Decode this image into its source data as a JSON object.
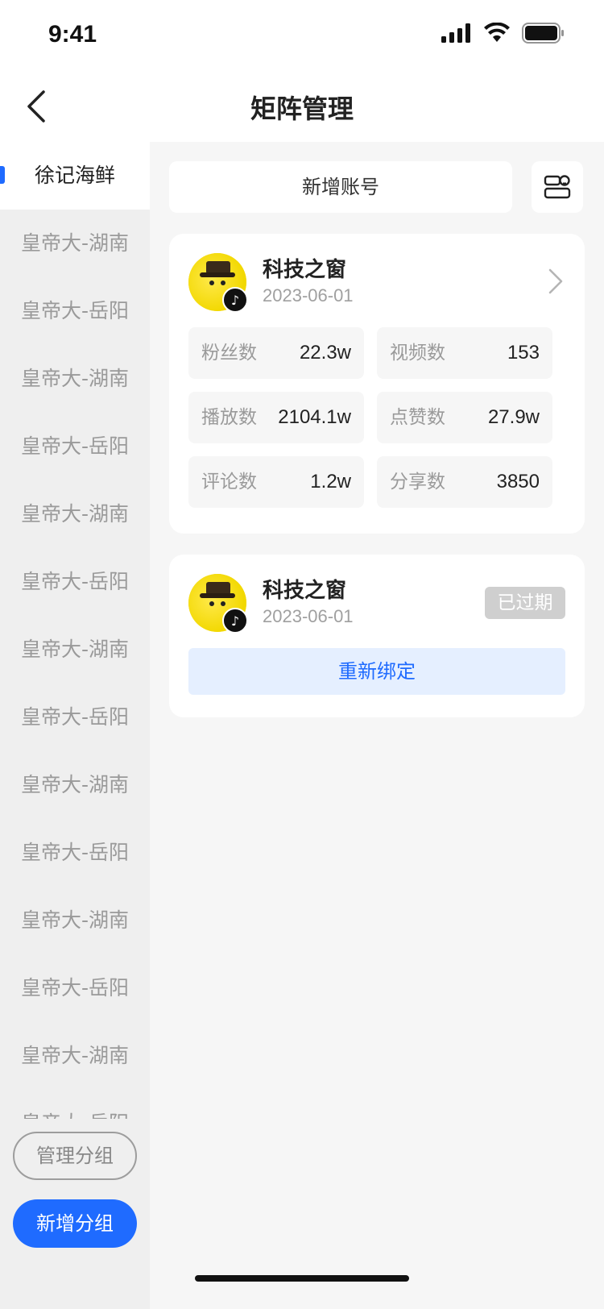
{
  "status_bar": {
    "time": "9:41",
    "icons": [
      "signal-icon",
      "wifi-icon",
      "battery-icon"
    ]
  },
  "nav": {
    "title": "矩阵管理",
    "back_icon": "chevron-left-icon"
  },
  "sidebar": {
    "items": [
      {
        "label": "徐记海鲜",
        "active": true
      },
      {
        "label": "皇帝大-湖南"
      },
      {
        "label": "皇帝大-岳阳"
      },
      {
        "label": "皇帝大-湖南"
      },
      {
        "label": "皇帝大-岳阳"
      },
      {
        "label": "皇帝大-湖南"
      },
      {
        "label": "皇帝大-岳阳"
      },
      {
        "label": "皇帝大-湖南"
      },
      {
        "label": "皇帝大-岳阳"
      },
      {
        "label": "皇帝大-湖南"
      },
      {
        "label": "皇帝大-岳阳"
      },
      {
        "label": "皇帝大-湖南"
      },
      {
        "label": "皇帝大-岳阳"
      },
      {
        "label": "皇帝大-湖南"
      },
      {
        "label": "皇帝大-岳阳"
      }
    ],
    "manage_group_label": "管理分组",
    "add_group_label": "新增分组"
  },
  "content": {
    "add_account_label": "新增账号",
    "accounts": [
      {
        "name": "科技之窗",
        "date": "2023-06-01",
        "stats": {
          "fans": {
            "label": "粉丝数",
            "value": "22.3w"
          },
          "videos": {
            "label": "视频数",
            "value": "153"
          },
          "plays": {
            "label": "播放数",
            "value": "2104.1w"
          },
          "likes": {
            "label": "点赞数",
            "value": "27.9w"
          },
          "comments": {
            "label": "评论数",
            "value": "1.2w"
          },
          "shares": {
            "label": "分享数",
            "value": "3850"
          }
        }
      },
      {
        "name": "科技之窗",
        "date": "2023-06-01",
        "status": "已过期",
        "rebind_label": "重新绑定"
      }
    ]
  },
  "colors": {
    "accent": "#1f6bff",
    "page_bg": "#f6f6f6",
    "sidebar_bg": "#efefef",
    "expired_badge": "#cfcfcf",
    "rebind_bg": "#e5efff"
  }
}
